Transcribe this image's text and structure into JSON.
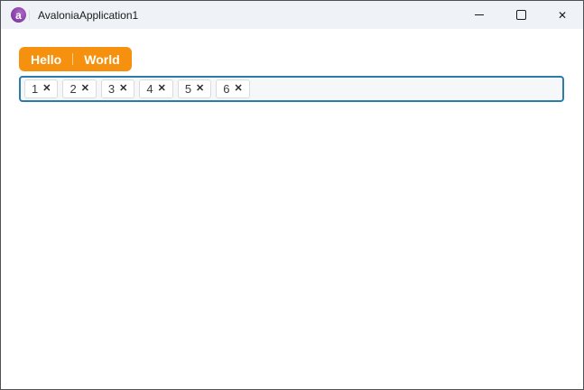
{
  "window": {
    "title": "AvaloniaApplication1",
    "logo_letter": "a"
  },
  "glyphs": {
    "close": "✕",
    "chip_close": "✕"
  },
  "tabstrip": {
    "tabs": [
      "Hello",
      "World"
    ]
  },
  "chipbar": {
    "items": [
      "1",
      "2",
      "3",
      "4",
      "5",
      "6"
    ]
  },
  "colors": {
    "accent_orange": "#F6910F",
    "focus_border_blue": "#2B7CAB",
    "titlebar_bg": "#EFF3F7",
    "logo_purple": "#8B44AC",
    "window_border": "#4E5257"
  }
}
